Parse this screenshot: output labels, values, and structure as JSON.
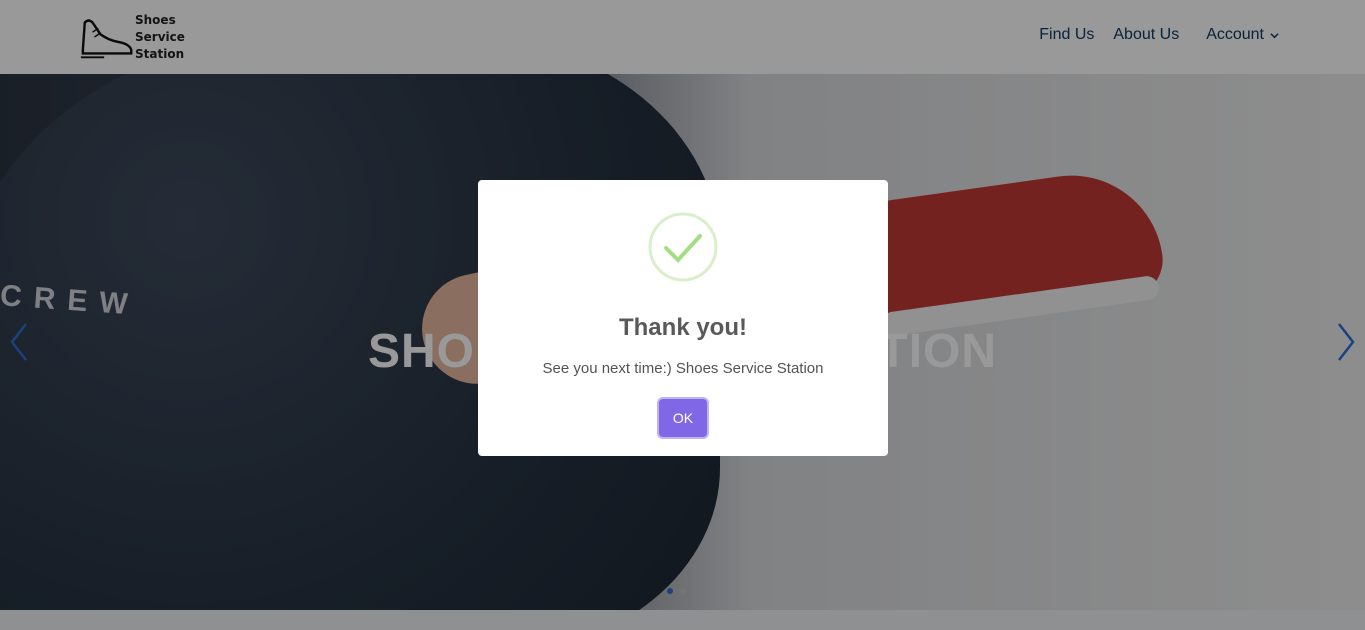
{
  "header": {
    "logo_text_lines": [
      "Shoes",
      "Service",
      "Station"
    ],
    "nav": {
      "find_us": "Find Us",
      "about_us": "About Us",
      "account": "Account"
    }
  },
  "hero": {
    "background_text": "CREW",
    "title": "SHOES SERVICE STATION",
    "carousel": {
      "slides": 3,
      "active": 1
    }
  },
  "modal": {
    "icon": "success-check-icon",
    "title": "Thank you!",
    "message": "See you next time:) Shoes Service Station",
    "ok_label": "OK"
  },
  "colors": {
    "nav_text": "#0f3b66",
    "ok_button": "#7f67e6",
    "success": "#a5dc86"
  }
}
